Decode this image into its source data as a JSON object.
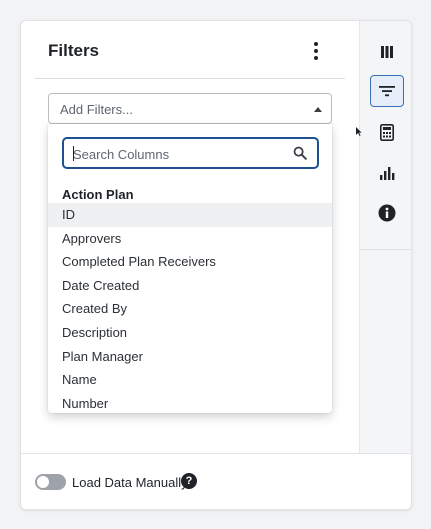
{
  "panel": {
    "title": "Filters"
  },
  "add_filters": {
    "placeholder": "Add Filters..."
  },
  "dropdown": {
    "search_placeholder": "Search Columns",
    "group_header": "Action Plan",
    "options": [
      "ID",
      "Approvers",
      "Completed Plan Receivers",
      "Date Created",
      "Created By",
      "Description",
      "Plan Manager",
      "Name",
      "Number"
    ],
    "highlighted_option": "ID"
  },
  "rail": {
    "items": [
      {
        "icon": "columns-icon",
        "active": false
      },
      {
        "icon": "filter-icon",
        "active": true
      },
      {
        "icon": "calculator-icon",
        "active": false
      },
      {
        "icon": "bar-chart-icon",
        "active": false
      },
      {
        "icon": "info-icon",
        "active": false
      }
    ]
  },
  "footer": {
    "toggle_label": "Load Data Manually",
    "toggle_on": false,
    "help_icon": "question-circle-icon"
  },
  "colors": {
    "accent": "#1d4f91",
    "active_rail_border": "#3a6fb7",
    "active_rail_bg": "#e6eef9",
    "text": "#1f2328"
  }
}
